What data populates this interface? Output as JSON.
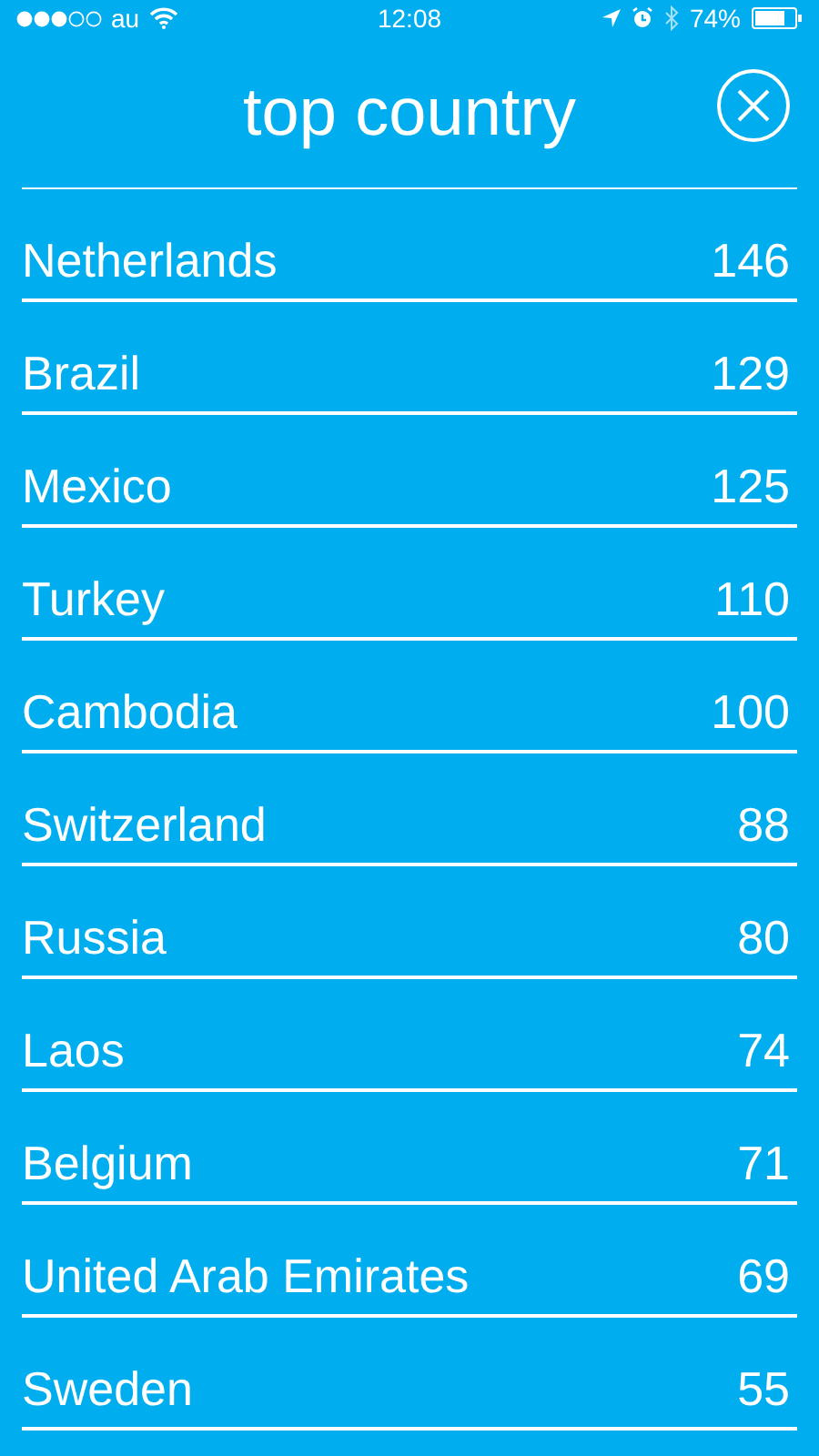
{
  "status_bar": {
    "carrier": "au",
    "time": "12:08",
    "battery": "74%"
  },
  "title": "top country",
  "rows": [
    {
      "country": "Netherlands",
      "count": "146"
    },
    {
      "country": "Brazil",
      "count": "129"
    },
    {
      "country": "Mexico",
      "count": "125"
    },
    {
      "country": "Turkey",
      "count": "110"
    },
    {
      "country": "Cambodia",
      "count": "100"
    },
    {
      "country": "Switzerland",
      "count": "88"
    },
    {
      "country": "Russia",
      "count": "80"
    },
    {
      "country": "Laos",
      "count": "74"
    },
    {
      "country": "Belgium",
      "count": "71"
    },
    {
      "country": "United Arab Emirates",
      "count": "69"
    },
    {
      "country": "Sweden",
      "count": "55"
    }
  ]
}
